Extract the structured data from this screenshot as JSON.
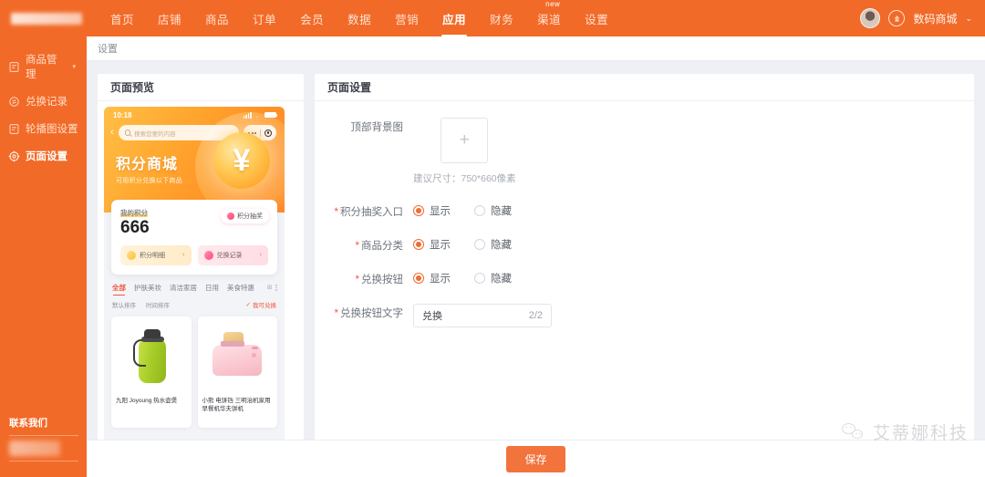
{
  "topnav": {
    "items": [
      {
        "label": "首页",
        "active": false
      },
      {
        "label": "店铺",
        "active": false
      },
      {
        "label": "商品",
        "active": false
      },
      {
        "label": "订单",
        "active": false
      },
      {
        "label": "会员",
        "active": false
      },
      {
        "label": "数据",
        "active": false
      },
      {
        "label": "营销",
        "active": false
      },
      {
        "label": "应用",
        "active": true
      },
      {
        "label": "财务",
        "active": false
      },
      {
        "label": "渠道",
        "active": false,
        "badge": "new"
      },
      {
        "label": "设置",
        "active": false
      }
    ],
    "shop_name": "数码商城",
    "chevron": "⌄",
    "upload_icon": "upload-icon",
    "avatar_icon": "user-avatar"
  },
  "sidebar": {
    "items": [
      {
        "label": "商品管理",
        "icon": "clipboard-icon",
        "active": false,
        "expandable": true,
        "chevron": "▾"
      },
      {
        "label": "兑换记录",
        "icon": "exchange-circle-icon",
        "active": false,
        "expandable": false
      },
      {
        "label": "轮播图设置",
        "icon": "clipboard-icon",
        "active": false,
        "expandable": false
      },
      {
        "label": "页面设置",
        "icon": "gear-icon",
        "active": true,
        "expandable": false
      }
    ],
    "contact_title": "联系我们"
  },
  "breadcrumb": {
    "text": "设置"
  },
  "preview": {
    "panel_title": "页面预览",
    "phone": {
      "status_time": "10:18",
      "search_placeholder": "搜索您要的内容",
      "hero_title": "积分商城",
      "hero_subtitle": "可用积分兑换以下商品",
      "hero_symbol": "¥",
      "points_label": "我的积分",
      "points_value": "666",
      "lottery_badge": "积分抽奖",
      "btn_detail": "积分明细",
      "btn_records": "兑换记录",
      "arrow": "›",
      "tabs": [
        "全部",
        "护肤美妆",
        "清洁家居",
        "日用",
        "美食特惠"
      ],
      "tab_active_index": 0,
      "sort_default": "默认排序",
      "sort_time": "时间排序",
      "filter_redeemable": "我可兑换",
      "products": [
        {
          "name": "九阳 Joyoung 热水壶煲",
          "image": "green-thermos"
        },
        {
          "name": "小熊 电饼铛 三明治机家用早餐机华夫饼机",
          "image": "pink-toaster"
        }
      ]
    }
  },
  "settings": {
    "panel_title": "页面设置",
    "fields": {
      "bg_image": {
        "label": "顶部背景图",
        "plus": "+",
        "hint": "建议尺寸：750*660像素"
      },
      "lottery_entry": {
        "label": "积分抽奖入口",
        "required": true,
        "options": [
          "显示",
          "隐藏"
        ],
        "selected": 0
      },
      "product_category": {
        "label": "商品分类",
        "required": true,
        "options": [
          "显示",
          "隐藏"
        ],
        "selected": 0
      },
      "redeem_button": {
        "label": "兑换按钮",
        "required": true,
        "options": [
          "显示",
          "隐藏"
        ],
        "selected": 0
      },
      "redeem_text": {
        "label": "兑换按钮文字",
        "required": true,
        "value": "兑换",
        "counter": "2/2"
      }
    }
  },
  "footer": {
    "save_label": "保存"
  },
  "watermark": {
    "text": "艾蒂娜科技",
    "icon": "wechat-icon"
  },
  "colors": {
    "brand_orange": "#F26A28",
    "accent_orange": "#F2733C",
    "required_red": "#F2553D",
    "page_bg": "#eef0f5"
  }
}
